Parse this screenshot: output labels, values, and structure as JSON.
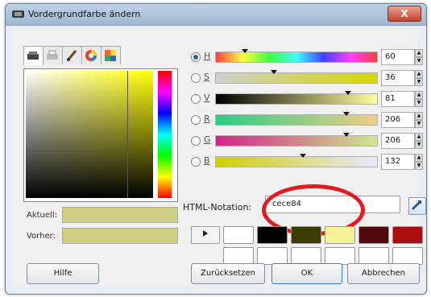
{
  "window": {
    "title": "Vordergrundfarbe ändern",
    "close_glyph": "X"
  },
  "tabs": [
    {
      "icon": "scanner-icon",
      "active": true
    },
    {
      "icon": "printer-icon",
      "active": false
    },
    {
      "icon": "paintbrush-icon",
      "active": false
    },
    {
      "icon": "color-wheel-icon",
      "active": false
    },
    {
      "icon": "palette-icon",
      "active": false
    }
  ],
  "current_label": "Aktuell:",
  "previous_label": "Vorher:",
  "current_color": "#cece84",
  "previous_color": "#cece84",
  "channels": [
    {
      "label": "H",
      "value": "60",
      "selected": true
    },
    {
      "label": "S",
      "value": "36",
      "selected": false
    },
    {
      "label": "V",
      "value": "81",
      "selected": false
    },
    {
      "label": "R",
      "value": "206",
      "selected": false
    },
    {
      "label": "G",
      "value": "206",
      "selected": false
    },
    {
      "label": "B",
      "value": "132",
      "selected": false
    }
  ],
  "html_notation_label": "HTML-Notation:",
  "html_value": "cece84",
  "history_colors": [
    "#ffffff",
    "#000000",
    "#3d3d00",
    "#f4f398",
    "#4f0b0b",
    "#aa1010",
    "#ffffff",
    "#ffffff",
    "#ffffff",
    "#ffffff",
    "#ffffff",
    "#ffffff"
  ],
  "buttons": {
    "help": "Hilfe",
    "reset": "Zurücksetzen",
    "ok": "OK",
    "cancel": "Abbrechen"
  }
}
